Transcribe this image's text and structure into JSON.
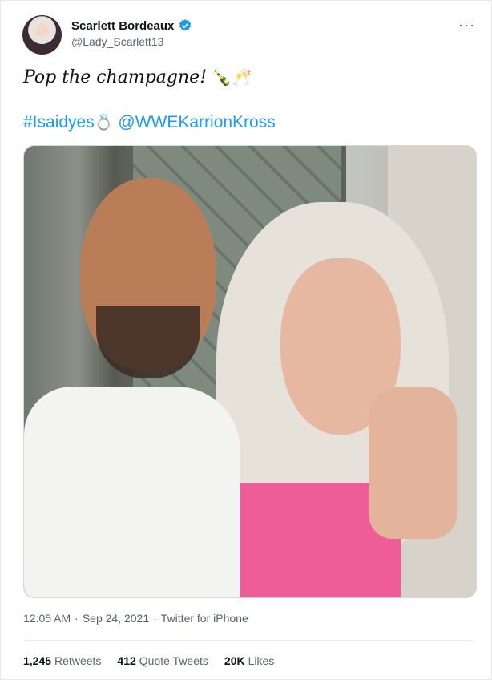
{
  "author": {
    "name": "Scarlett Bordeaux",
    "handle": "@Lady_Scarlett13",
    "avatar_icon": "profile-avatar",
    "verified_icon": "verified-badge-icon",
    "verified_color": "#1d9bf0"
  },
  "more_icon": "···",
  "tweet": {
    "text": "Pop the champagne!",
    "emoji": "🍾🥂",
    "hashtag": "#Isaidyes",
    "hashtag_emoji": "💍",
    "mention": "@WWEKarrionKross"
  },
  "photo": {
    "description_icon": "tweet-photo"
  },
  "meta": {
    "time": "12:05 AM",
    "separator": "·",
    "date": "Sep 24, 2021",
    "separator2": "·",
    "source": "Twitter for iPhone"
  },
  "stats": {
    "retweets_count": "1,245",
    "retweets_label": "Retweets",
    "quotes_count": "412",
    "quotes_label": "Quote Tweets",
    "likes_count": "20K",
    "likes_label": "Likes"
  },
  "colors": {
    "link": "#1d9bf0",
    "muted": "#536471",
    "text": "#0f1419"
  }
}
